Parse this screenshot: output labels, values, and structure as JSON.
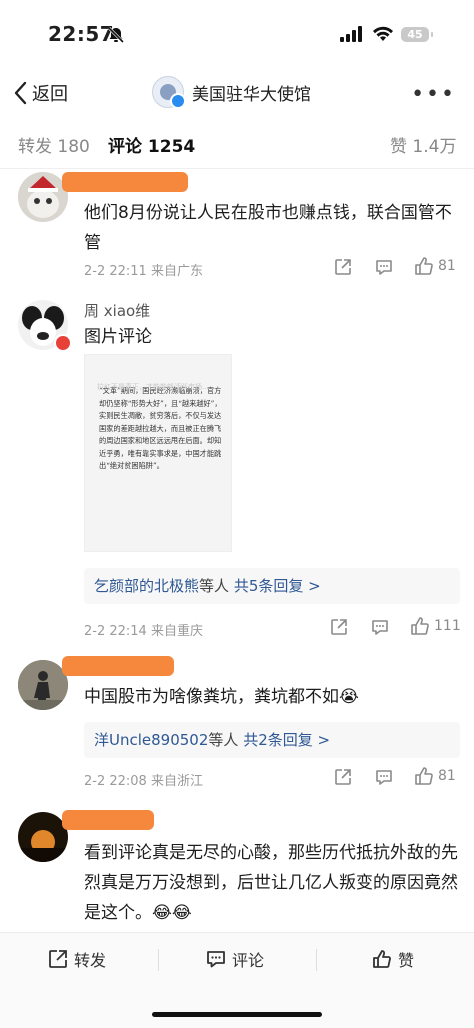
{
  "status": {
    "time": "22:57",
    "battery": "45"
  },
  "nav": {
    "back_label": "返回",
    "title": "美国驻华大使馆",
    "more": "•••"
  },
  "tabs": {
    "repost_label": "转发",
    "repost_count": "180",
    "comment_label": "评论",
    "comment_count": "1254",
    "like_label": "赞",
    "like_count": "1.4万"
  },
  "comments": [
    {
      "username": "",
      "text": "他们8月份说让人民在股市也赚点钱，联合国管不管",
      "time": "2-2 22:11",
      "location": "来自广东",
      "likes": "81"
    },
    {
      "username": "周 xiao维",
      "text": "图片评论",
      "image_text_faint": "拉红不是真正，才能能够活跃市场...",
      "image_text": "“文革”期间，国民经济濒临崩溃，官方却仍坚称“形势大好”，且“越来越好”，实则民生凋敝，贫穷落后，不仅与发达国家的差距越拉越大，而且被正在腾飞的周边国家和地区远远甩在后面。却知近乎勇，唯有靠实事求是，中国才能跳出“绝对贫困陷阱”。",
      "reply_names": "乞颜部的北极熊",
      "reply_mid": "等人",
      "reply_count": "共5条回复 >",
      "time": "2-2 22:14",
      "location": "来自重庆",
      "likes": "111"
    },
    {
      "username": "",
      "text": "中国股市为啥像粪坑，粪坑都不如😭",
      "reply_names": "洋Uncle890502",
      "reply_mid": "等人",
      "reply_count": "共2条回复 >",
      "time": "2-2 22:08",
      "location": "来自浙江",
      "likes": "81"
    },
    {
      "username": "",
      "text": "看到评论真是无尽的心酸，那些历代抵抗外敌的先烈真是万万没想到，后世让几亿人叛变的原因竟然是这个。😂😂"
    }
  ],
  "bottom": {
    "repost": "转发",
    "comment": "评论",
    "like": "赞"
  },
  "colors": {
    "accent": "#f5883d",
    "link": "#2f5894",
    "verified": "#2a8cf0"
  }
}
